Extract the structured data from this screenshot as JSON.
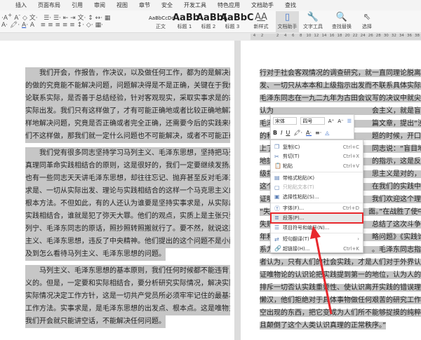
{
  "tabs": [
    "插入",
    "页面布局",
    "引用",
    "审阅",
    "视图",
    "章节",
    "安全",
    "开发工具",
    "特色应用",
    "文档助手",
    "查找"
  ],
  "ribbon": {
    "styles": [
      {
        "preview": "AaBbCcDd",
        "label": "正文"
      },
      {
        "preview": "AaBb",
        "label": "标题 1"
      },
      {
        "preview": "AaBb(",
        "label": "标题 2"
      },
      {
        "preview": "AaBbC",
        "label": "标题 3"
      }
    ],
    "new_style": "新样式",
    "doc_assistant": "文档助手",
    "text_tools": "文字工具",
    "find_replace": "查找替换",
    "select": "选择"
  },
  "ruler": [
    "4",
    "2",
    "",
    "2",
    "4",
    "6",
    "8",
    "10",
    "12",
    "14",
    "16",
    "18",
    "20",
    "22",
    "24",
    "26",
    "28",
    "30",
    "32",
    "34",
    "36",
    "38"
  ],
  "left_page": {
    "paragraphs": [
      [
        "　　我们开会，作报告，作决议，以及做任何工作，都为的是解决问题。我们说",
        "的做的究竟能不能解决问题，问题解决得是不是正确，关键在于我们是否能够理",
        "论联系实际，是否善于总结经验，针对客观现实，采取实事求是的态度，一切从",
        "实际出发。我们只有这样做了，才有可能正确地或者比较正确地解决问题，而这",
        "样地解决问题，究竟是否正确或者完全正确，还需要今后的实践来检验。如果我",
        "们不这样做，那我们就一定什么问题也不可能解决，或者不可能正确地解决。"
      ],
      [
        "　　我们党有很多同志坚持学习马列主义、毛泽东思想，坚持把马列主义的普遍",
        "真理同革命实践相结合的原则，这是很好的，我们一定要继续发扬。但是，我们",
        "也有一些同志天天讲毛泽东思想，却往往忘记、抛弃甚至反对毛泽东同志的实事",
        "求是、一切从实际出发、理论与实践相结合的这样一个马克思主义的根本观点，",
        "根本方法。不但如此，有的人还认为谁要是坚持实事求是，从实际出发，理论和",
        "实践相结合，谁就是犯了弥天大罪。他们的观点，实质上是主张只要照抄马克思、",
        "列宁、毛泽东同志的原话，照抄照转照搬就行了。要不然，就说这是违反了马列",
        "主义、毛泽东思想，违反了中央精神。他们提出的这个问题不是小问题，而是涉",
        "及到怎么看待马列主义、毛泽东思想的问题。"
      ],
      [
        "　　马列主义、毛泽东思想的基本原则，我们任何时候都不能违背，这是毫无疑",
        "义的。但是，一定要和实际相结合，要分析研究实际情况，解决实际问题。按照",
        "实际情况决定工作方针，这是一切共产党员所必须牢牢记住的最基本的思想方法、",
        "工作方法。实事求是，是毛泽东思想的出发点、根本点。这是唯物主义。不然，",
        "我们开会就只能讲空话，不能解决任何问题。"
      ]
    ]
  },
  "right_page": {
    "lines": [
      "行对于社会客观情况的调查研究，就一直同理论脱离实际、一切只从",
      "发、一切只从本本和上级指示出发而不联系具体实际的错误倾向作斗",
      "毛泽东同志在一九二九年为古田会议写的决议中就尖锐地反对主观主",
      "认为　　　　　　　　　　　　　　会主义，就是盲动主义”。一",
      "毛泽　　　　　　　　　　　　　　篇文章，提出“没有调查，没",
      "的科　　　　　　　　　　　　　　题的时候，开口闭口拿本",
      "上了　　　　　　　　　　　　　　同志说：“盲目地表面上",
      "地执　　　　　　　　　　　　　　的指示，这是反对上级指",
      "级指　　　　　　　　　　　　　　思主义是对的，决不是",
      "这个　　　　　　　　　　　　　　在我们的实践中，在我们",
      "证明　　　　　　　　　　　　　　我们欢迎这个理论，丝",
      "“失　　　　　　　　　　　　　　面。”在战胜了使中国革",
      "失败　　　　　　　　　　　　　　总结了这次斗争的教训，",
      "年和　　　　　　　　　　　　　　略问题》《实践论》《矛",
      "系为　　　　　　　　　　　　　　。毛泽东同志指出：“",
      "者认为，只有人们的社会实践，才是人们对于外界认识的真理性的标",
      "证唯物论的认识论把实践提到第一的地位，认为人的认识一点也不能",
      "排斥一切否认实践重要性、使认识离开实践的错误理论。”“我们的教",
      "懒汉，他们拒绝对于具体事物做任何艰苦的研究工作，他们把一般真",
      "空出现的东西，把它变成为人们所不能够捉摸的纯粹抽象的公式，完",
      "且颠倒了这个人类认识真理的正常秩序。”"
    ]
  },
  "mini_toolbar": {
    "font": "宋体",
    "size": "四号"
  },
  "context_menu": [
    {
      "label": "复制(C)",
      "shortcut": "Ctrl+C",
      "icon": "copy-icon",
      "glyph": "❐"
    },
    {
      "label": "剪切(T)",
      "shortcut": "Ctrl+X",
      "icon": "cut-icon",
      "glyph": "✂"
    },
    {
      "label": "粘贴",
      "shortcut": "Ctrl+V",
      "icon": "paste-icon",
      "glyph": "📋"
    },
    {
      "label": "带格式粘贴(K)",
      "shortcut": "",
      "icon": "paste-format-icon",
      "glyph": "▤"
    },
    {
      "label": "只粘贴文本(T)",
      "shortcut": "",
      "icon": "paste-text-icon",
      "glyph": "▢",
      "disabled": true
    },
    {
      "label": "选择性粘贴(S)...",
      "shortcut": "",
      "icon": "paste-special-icon",
      "glyph": "▣"
    },
    {
      "label": "字体(F)...",
      "shortcut": "Ctrl+D",
      "icon": "font-icon",
      "glyph": "Ⓣ"
    },
    {
      "label": "段落(P)...",
      "shortcut": "",
      "icon": "paragraph-icon",
      "glyph": "≣",
      "highlighted": true
    },
    {
      "label": "项目符号和编号(N)...",
      "shortcut": "",
      "icon": "list-icon",
      "glyph": "☰"
    },
    {
      "label": "短句翻译(T)",
      "shortcut": "›",
      "icon": "translate-icon",
      "glyph": "⇄"
    },
    {
      "label": "超链接(H)...",
      "shortcut": "Ctrl+K",
      "icon": "link-icon",
      "glyph": "🔗"
    }
  ],
  "colors": {
    "highlight": "#e8282d",
    "selection": "#c6c6c6"
  }
}
